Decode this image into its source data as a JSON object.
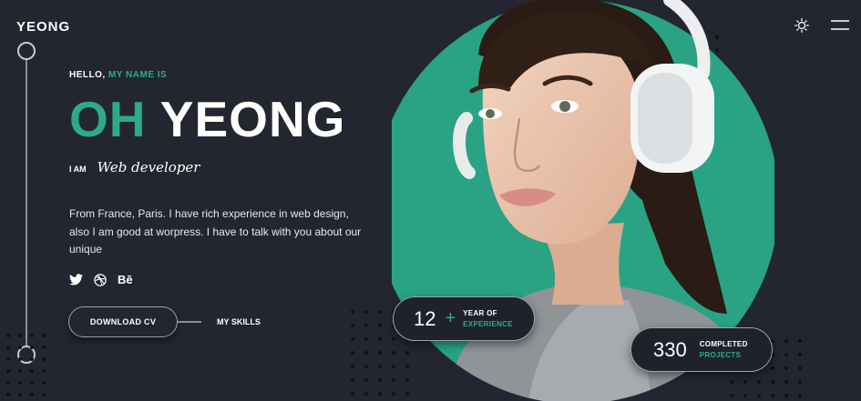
{
  "brand": {
    "logo": "YEONG"
  },
  "header": {
    "theme_icon": "sun-icon",
    "menu_icon": "hamburger-menu-icon"
  },
  "hero": {
    "greeting": "HELLO,",
    "greeting_accent": "MY NAME IS",
    "first_name": "OH",
    "last_name": "YEONG",
    "role_prefix": "I AM",
    "role": "Web developer",
    "bio": "From France, Paris. I have rich experience in web design, also I am good at worpress. I have to talk with you about our unique",
    "socials": [
      {
        "icon": "twitter-icon"
      },
      {
        "icon": "dribbble-icon"
      },
      {
        "icon": "behance-icon",
        "label": "Bē"
      }
    ],
    "download_label": "DOWNLOAD CV",
    "skills_label": "MY SKILLS"
  },
  "stats": {
    "experience": {
      "value": "12",
      "suffix": "+",
      "line1": "YEAR OF",
      "line2": "EXPERIENCE"
    },
    "projects": {
      "value": "330",
      "line1": "COMPLETED",
      "line2": "PROJECTS"
    }
  },
  "colors": {
    "background": "#232630",
    "accent": "#2eab86",
    "text": "#ffffff"
  },
  "photo": {
    "subject": "woman-with-headphones-portrait"
  }
}
